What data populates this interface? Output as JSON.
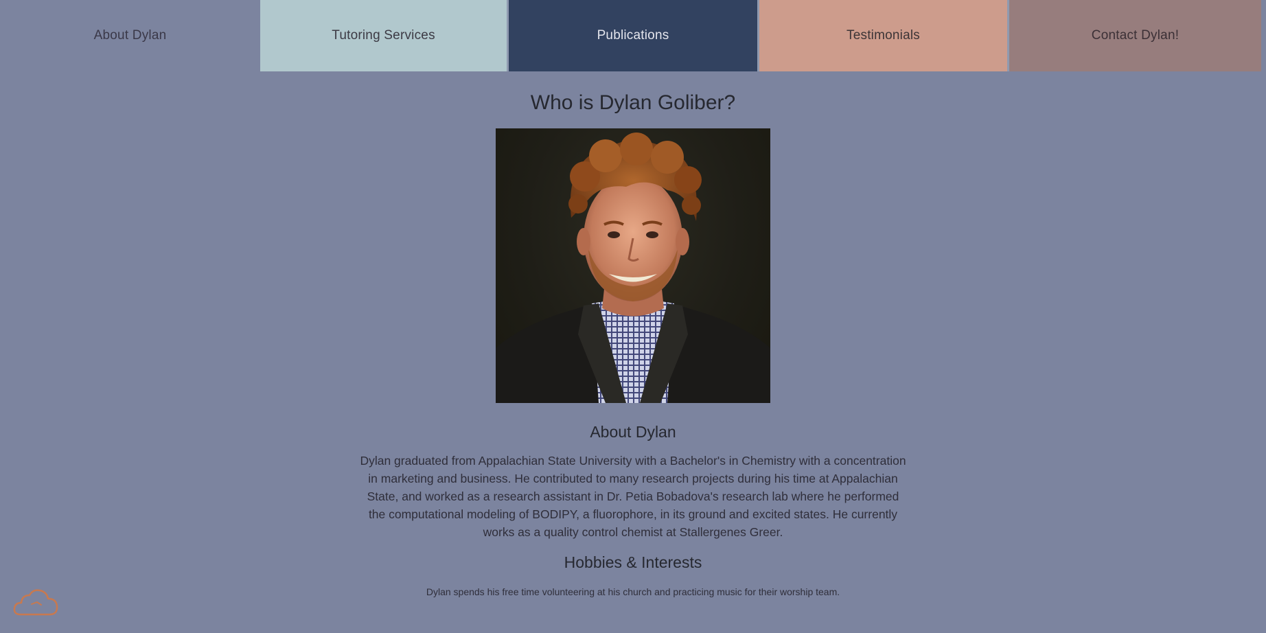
{
  "nav": {
    "items": [
      {
        "label": "About Dylan",
        "color": "#7c849f"
      },
      {
        "label": "Tutoring Services",
        "color": "#b1c8cd"
      },
      {
        "label": "Publications",
        "color": "#324260"
      },
      {
        "label": "Testimonials",
        "color": "#cd9c8c"
      },
      {
        "label": "Contact Dylan!",
        "color": "#977d7d"
      }
    ]
  },
  "main": {
    "title": "Who is Dylan Goliber?",
    "photo_icon": "portrait-photo",
    "about_title": "About Dylan",
    "about_text": "Dylan graduated from Appalachian State University with a Bachelor's in Chemistry with a concentration in marketing and business. He contributed to many research projects during his time at Appalachian State, and worked as a research assistant in Dr. Petia Bobadova's research lab where he performed the computational modeling of BODIPY, a fluorophore, in its ground and excited states. He currently works as a quality control chemist at Stallergenes Greer.",
    "hobbies_title": "Hobbies & Interests",
    "hobbies_text": "Dylan spends his free time volunteering at his church and practicing music for their worship team."
  },
  "colors": {
    "background": "#7c849f",
    "cloud_icon": "#c8794f"
  },
  "widget": {
    "icon": "cloud-icon"
  }
}
